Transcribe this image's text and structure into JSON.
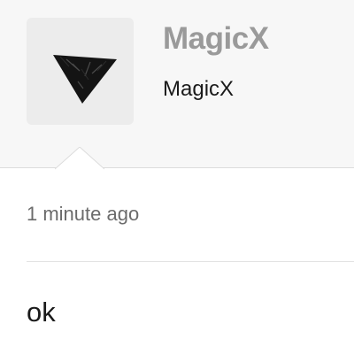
{
  "user": {
    "display_name": "MagicX",
    "username": "MagicX",
    "avatar_icon": "dark-triangle-logo"
  },
  "post": {
    "timestamp": "1 minute ago",
    "message": "ok"
  },
  "colors": {
    "header_background": "#f7f7f7",
    "avatar_background": "#ececec",
    "display_name": "#9a9a9a",
    "text": "#1a1a1a",
    "muted": "#6b6b6b"
  }
}
